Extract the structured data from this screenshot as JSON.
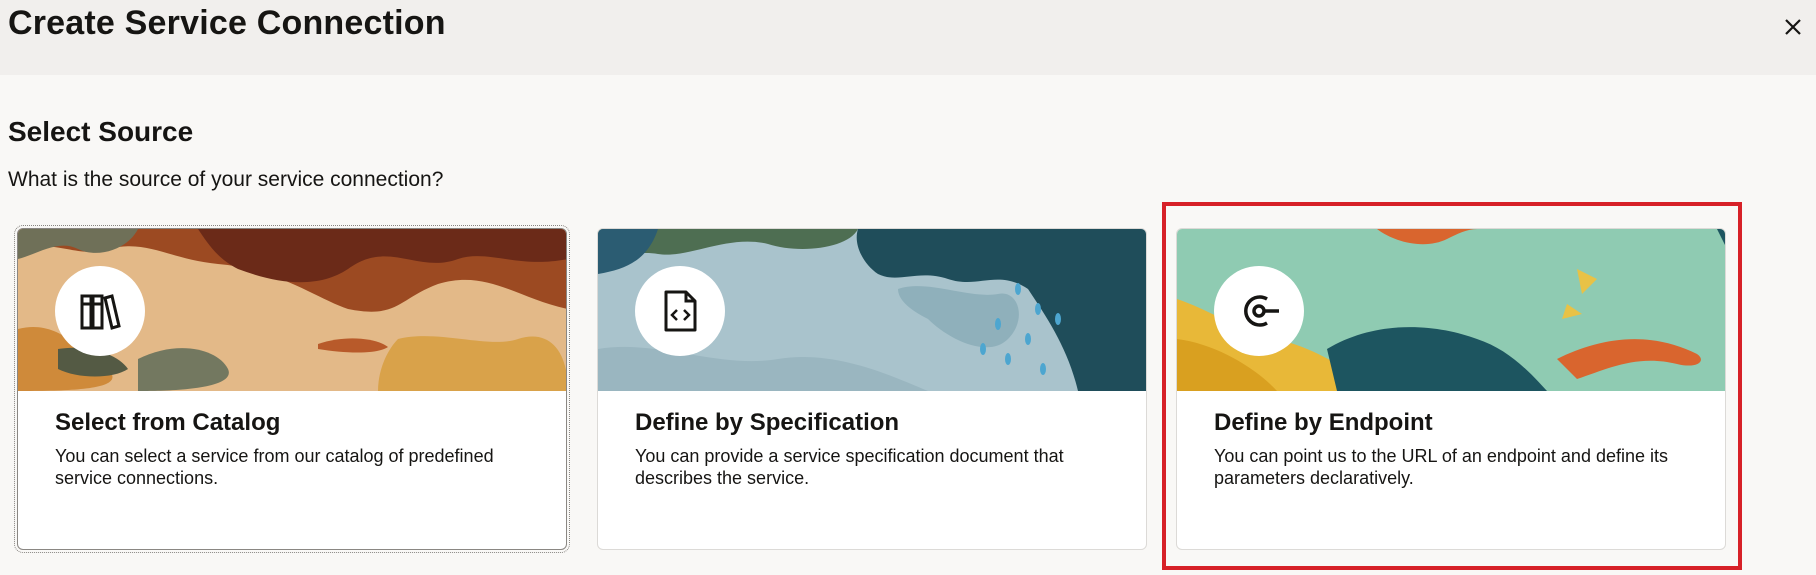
{
  "dialog": {
    "title": "Create Service Connection",
    "close_icon": "close-icon"
  },
  "section": {
    "title": "Select Source",
    "subtitle": "What is the source of your service connection?"
  },
  "cards": [
    {
      "title": "Select from Catalog",
      "description": "You can select a service from our catalog of predefined service connections.",
      "icon": "catalog-books-icon",
      "focused": true
    },
    {
      "title": "Define by Specification",
      "description": "You can provide a service specification document that describes the service.",
      "icon": "code-document-icon"
    },
    {
      "title": "Define by Endpoint",
      "description": "You can point us to the URL of an endpoint and define its parameters declaratively.",
      "icon": "endpoint-icon",
      "highlighted": true
    }
  ],
  "colors": {
    "header_bg": "#f1efed",
    "page_bg": "#f9f8f6",
    "highlight_border": "#d72128"
  }
}
